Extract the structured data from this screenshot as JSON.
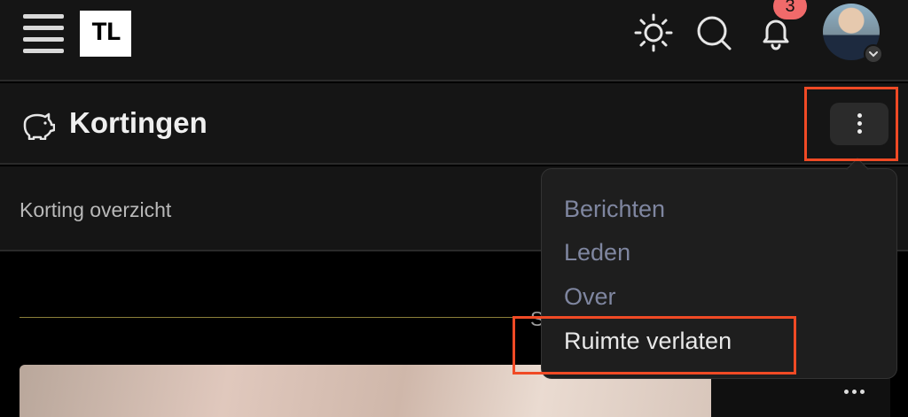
{
  "topbar": {
    "logo_text": "TL",
    "notification_count": "3"
  },
  "header": {
    "title": "Kortingen"
  },
  "subnav": {
    "label": "Korting overzicht"
  },
  "feed": {
    "divider_text": "S"
  },
  "menu": {
    "items": [
      {
        "label": "Berichten"
      },
      {
        "label": "Leden"
      },
      {
        "label": "Over"
      },
      {
        "label": "Ruimte verlaten"
      }
    ]
  },
  "colors": {
    "highlight": "#f04a25",
    "badge": "#f06a6a",
    "menu_text": "#7f86a0"
  }
}
